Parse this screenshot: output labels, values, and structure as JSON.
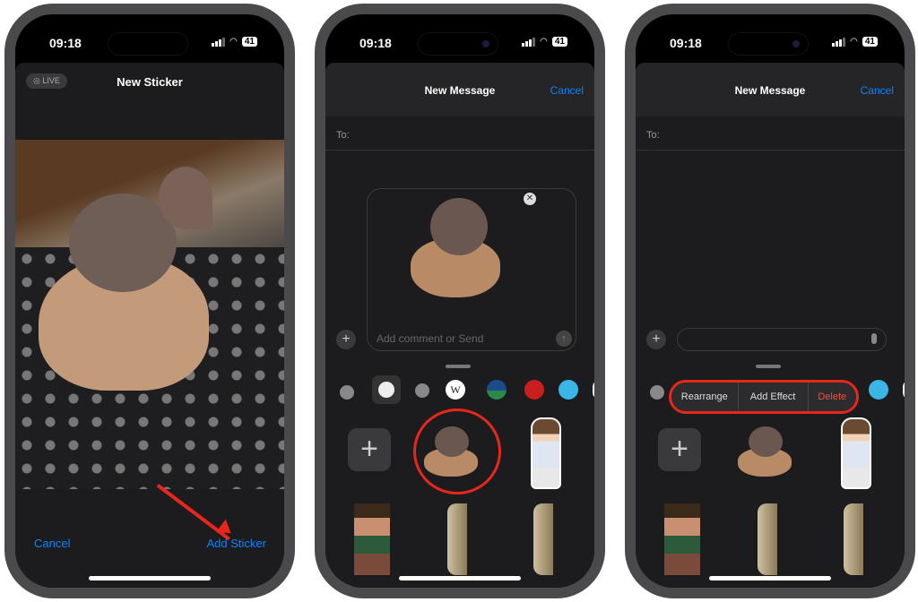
{
  "status": {
    "time": "09:18",
    "battery": "41"
  },
  "screen1": {
    "live_badge": "LIVE",
    "title": "New Sticker",
    "cancel": "Cancel",
    "add_sticker": "Add Sticker"
  },
  "screen2": {
    "title": "New Message",
    "cancel": "Cancel",
    "to_label": "To:",
    "comment_placeholder": "Add comment or Send"
  },
  "screen3": {
    "title": "New Message",
    "cancel": "Cancel",
    "to_label": "To:",
    "menu": [
      "Rearrange",
      "Add Effect",
      "Delete"
    ]
  },
  "tray_icons": [
    "recents-clock-icon",
    "stickers-icon",
    "emoji-icon",
    "wikipedia-icon",
    "app-icon-green",
    "app-icon-red",
    "app-icon-calendar",
    "app-icon-partial"
  ],
  "colors": {
    "accent": "#0a84ff",
    "annotation": "#e8261c",
    "delete": "#ff453a"
  }
}
